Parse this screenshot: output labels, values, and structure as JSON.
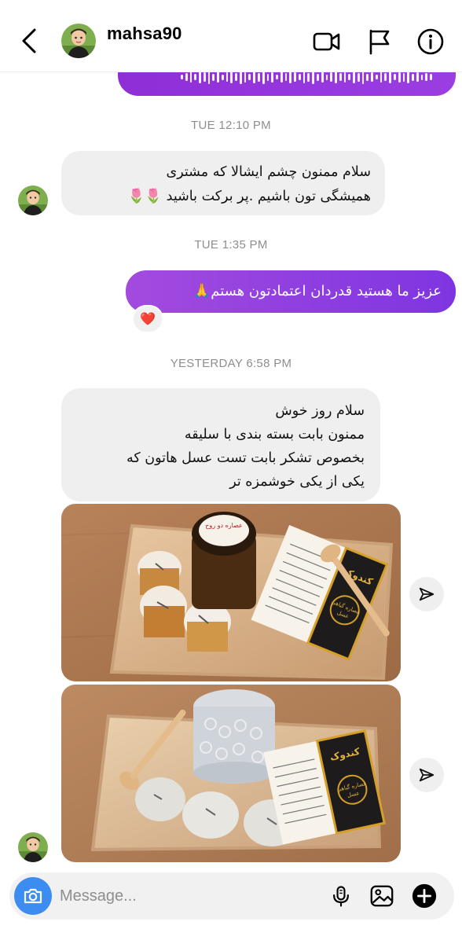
{
  "header": {
    "username": "mahsa90",
    "icons": [
      "back-icon",
      "video-call-icon",
      "flag-icon",
      "info-icon"
    ]
  },
  "thread": {
    "stamps": [
      "TUE 12:10 PM",
      "TUE 1:35 PM",
      "YESTERDAY 6:58 PM"
    ],
    "msg1_lines": [
      "سلام ممنون چشم ایشالا که مشتری",
      "همیشگی تون باشیم .پر برکت باشید 🌷🌷"
    ],
    "msg2": "عزیز ما هستید قدردان اعتمادتون هستم🙏",
    "msg2_reaction": "❤️",
    "msg3_lines": [
      "سلام روز خوش",
      "ممنون بابت بسته بندی با سلیقه",
      "بخصوص تشکر بابت تست عسل هاتون که",
      "یکی از یکی خوشمزه تر"
    ],
    "photo1_label_lines": [
      "کندوک",
      "عصاره گیاهی",
      "عسل"
    ],
    "photo1_jar_label": "عصاره دو روح",
    "photo2_label_lines": [
      "کندوک",
      "عصاره گیاهی",
      "عسل"
    ]
  },
  "composer": {
    "placeholder": "Message...",
    "icons": [
      "camera-icon",
      "microphone-icon",
      "gallery-icon",
      "plus-icon"
    ]
  },
  "colors": {
    "accent_purple": "#8e36e0",
    "camera_blue": "#3d8cf0",
    "bubble_gray": "#efefef",
    "timestamp_gray": "#8e8e8e"
  }
}
